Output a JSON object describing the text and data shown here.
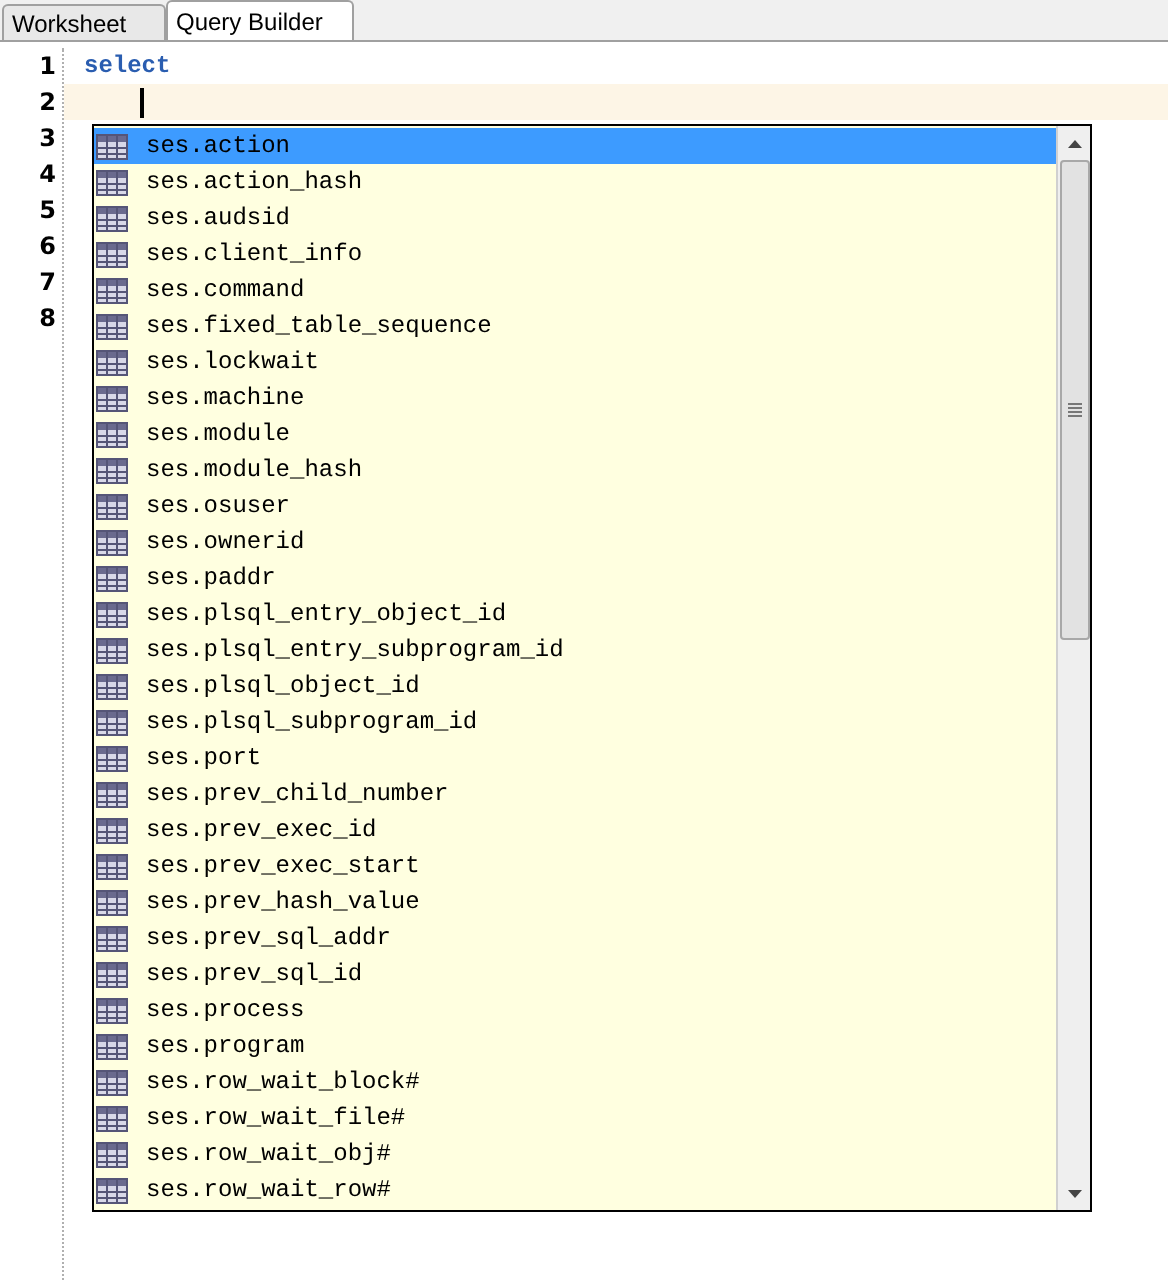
{
  "tabs": [
    {
      "label": "Worksheet",
      "selected": false
    },
    {
      "label": "Query Builder",
      "selected": true
    }
  ],
  "editor": {
    "line_numbers": [
      "1",
      "2",
      "3",
      "4",
      "5",
      "6",
      "7",
      "8"
    ],
    "lines": [
      {
        "text": "select",
        "current": false
      },
      {
        "current": true
      }
    ]
  },
  "completion_popup": {
    "items": [
      {
        "label": "ses.action",
        "selected": true
      },
      {
        "label": "ses.action_hash",
        "selected": false
      },
      {
        "label": "ses.audsid",
        "selected": false
      },
      {
        "label": "ses.client_info",
        "selected": false
      },
      {
        "label": "ses.command",
        "selected": false
      },
      {
        "label": "ses.fixed_table_sequence",
        "selected": false
      },
      {
        "label": "ses.lockwait",
        "selected": false
      },
      {
        "label": "ses.machine",
        "selected": false
      },
      {
        "label": "ses.module",
        "selected": false
      },
      {
        "label": "ses.module_hash",
        "selected": false
      },
      {
        "label": "ses.osuser",
        "selected": false
      },
      {
        "label": "ses.ownerid",
        "selected": false
      },
      {
        "label": "ses.paddr",
        "selected": false
      },
      {
        "label": "ses.plsql_entry_object_id",
        "selected": false
      },
      {
        "label": "ses.plsql_entry_subprogram_id",
        "selected": false
      },
      {
        "label": "ses.plsql_object_id",
        "selected": false
      },
      {
        "label": "ses.plsql_subprogram_id",
        "selected": false
      },
      {
        "label": "ses.port",
        "selected": false
      },
      {
        "label": "ses.prev_child_number",
        "selected": false
      },
      {
        "label": "ses.prev_exec_id",
        "selected": false
      },
      {
        "label": "ses.prev_exec_start",
        "selected": false
      },
      {
        "label": "ses.prev_hash_value",
        "selected": false
      },
      {
        "label": "ses.prev_sql_addr",
        "selected": false
      },
      {
        "label": "ses.prev_sql_id",
        "selected": false
      },
      {
        "label": "ses.process",
        "selected": false
      },
      {
        "label": "ses.program",
        "selected": false
      },
      {
        "label": "ses.row_wait_block#",
        "selected": false
      },
      {
        "label": "ses.row_wait_file#",
        "selected": false
      },
      {
        "label": "ses.row_wait_obj#",
        "selected": false
      },
      {
        "label": "ses.row_wait_row#",
        "selected": false
      }
    ]
  }
}
